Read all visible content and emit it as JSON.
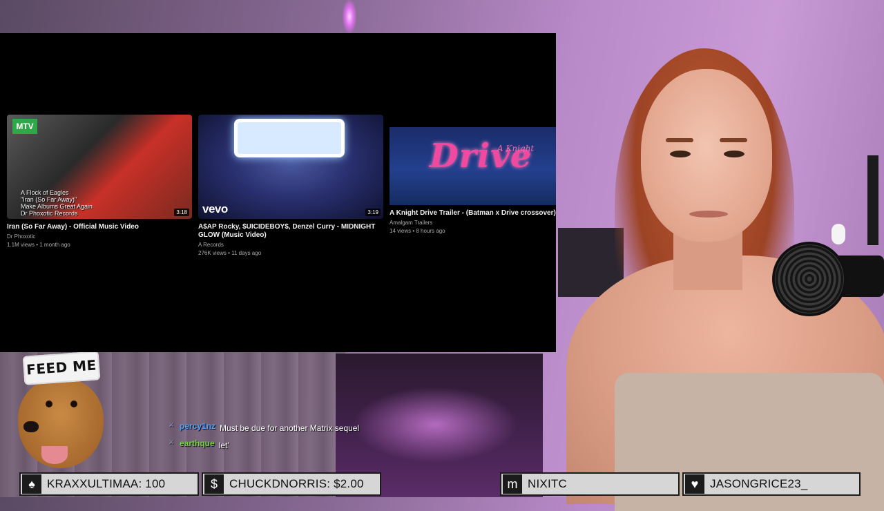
{
  "videos": [
    {
      "title": "Iran (So Far Away) - Official Music Video",
      "channel": "Dr Phoxotic",
      "meta": "1.1M views • 1 month ago",
      "duration": "3:18",
      "thumb_logo": "MTV",
      "thumb_caption": "A Flock of Eagles\n\"Iran (So Far Away)\"\nMake Albums Great Again\nDr Phoxotic Records"
    },
    {
      "title": "A$AP Rocky, $UICIDEBOY$, Denzel Curry - MIDNIGHT GLOW (Music Video)",
      "channel": "A Records",
      "meta": "276K views • 11 days ago",
      "duration": "3:19",
      "thumb_logo": "vevo"
    },
    {
      "title": "A Knight Drive Trailer - (Batman x Drive crossover)",
      "channel": "Amalgam Trailers",
      "meta": "14 views • 8 hours ago",
      "thumb_subtitle": "A Knight",
      "thumb_word": "Drive"
    }
  ],
  "overlay": {
    "feed_me": "FEED ME"
  },
  "chat": [
    {
      "user": "percy1nz",
      "message": "Must be due for another Matrix sequel",
      "badge_icon": "moderator-icon"
    },
    {
      "user": "earthque",
      "message": "let'",
      "badge_icon": "moderator-icon"
    }
  ],
  "ticker": [
    {
      "icon": "spade-icon",
      "glyph": "♠",
      "text": "KRAXXULTIMAA: 100"
    },
    {
      "icon": "dollar-icon",
      "glyph": "$",
      "text": "CHUCKDNORRIS: $2.00"
    },
    {
      "icon": "m-icon",
      "glyph": "m",
      "text": "NIXITC"
    },
    {
      "icon": "heart-icon",
      "glyph": "♥",
      "text": "JASONGRICE23_"
    }
  ]
}
